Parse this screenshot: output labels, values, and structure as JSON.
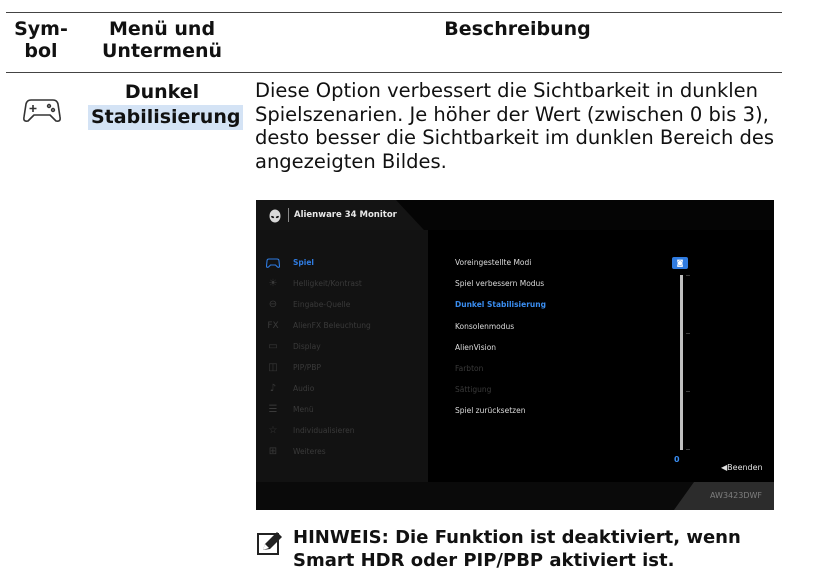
{
  "table": {
    "headers": {
      "symbol": [
        "Sym-",
        "bol"
      ],
      "menu": [
        "Menü und",
        "Untermenü"
      ],
      "description": "Beschreibung"
    },
    "row": {
      "icon": "gamepad-icon",
      "menu_line1": "Dunkel",
      "menu_line2": "Stabilisierung",
      "description": "Diese Option verbessert die Sichtbarkeit in dunklen Spielszenarien. Je höher der Wert (zwischen 0 bis 3), desto besser die Sichtbarkeit im dunklen Bereich des angezeigten Bildes."
    }
  },
  "osd": {
    "title": "Alienware 34 Monitor",
    "main_menu": [
      {
        "label": "Spiel",
        "icon": "gamepad-icon",
        "active": true
      },
      {
        "label": "Helligkeit/Kontrast",
        "icon": "brightness-icon",
        "active": false
      },
      {
        "label": "Eingabe-Quelle",
        "icon": "input-source-icon",
        "active": false
      },
      {
        "label": "AlienFX Beleuchtung",
        "icon": "alienfx-icon",
        "active": false
      },
      {
        "label": "Display",
        "icon": "display-icon",
        "active": false
      },
      {
        "label": "PIP/PBP",
        "icon": "pip-pbp-icon",
        "active": false
      },
      {
        "label": "Audio",
        "icon": "audio-icon",
        "active": false
      },
      {
        "label": "Menü",
        "icon": "menu-icon",
        "active": false
      },
      {
        "label": "Individualisieren",
        "icon": "star-icon",
        "active": false
      },
      {
        "label": "Weiteres",
        "icon": "others-icon",
        "active": false
      }
    ],
    "submenu": [
      {
        "label": "Voreingestellte Modi",
        "state": "normal"
      },
      {
        "label": "Spiel verbessern Modus",
        "state": "normal"
      },
      {
        "label": "Dunkel Stabilisierung",
        "state": "selected"
      },
      {
        "label": "Konsolenmodus",
        "state": "normal"
      },
      {
        "label": "AlienVision",
        "state": "normal"
      },
      {
        "label": "Farbton",
        "state": "disabled"
      },
      {
        "label": "Sättigung",
        "state": "disabled"
      },
      {
        "label": "Spiel zurücksetzen",
        "state": "normal"
      }
    ],
    "slider": {
      "value": "0",
      "min": 0,
      "max": 3,
      "fraction": 0.0
    },
    "exit_label": "◀Beenden",
    "model": "AW3423DWF",
    "colors": {
      "accent": "#2f7be0",
      "background": "#000000",
      "panel": "#121212"
    }
  },
  "note": {
    "icon": "pencil-note-icon",
    "line1": "HINWEIS: Die Funktion ist deaktiviert, wenn",
    "line2": "Smart HDR oder PIP/PBP aktiviert ist."
  }
}
